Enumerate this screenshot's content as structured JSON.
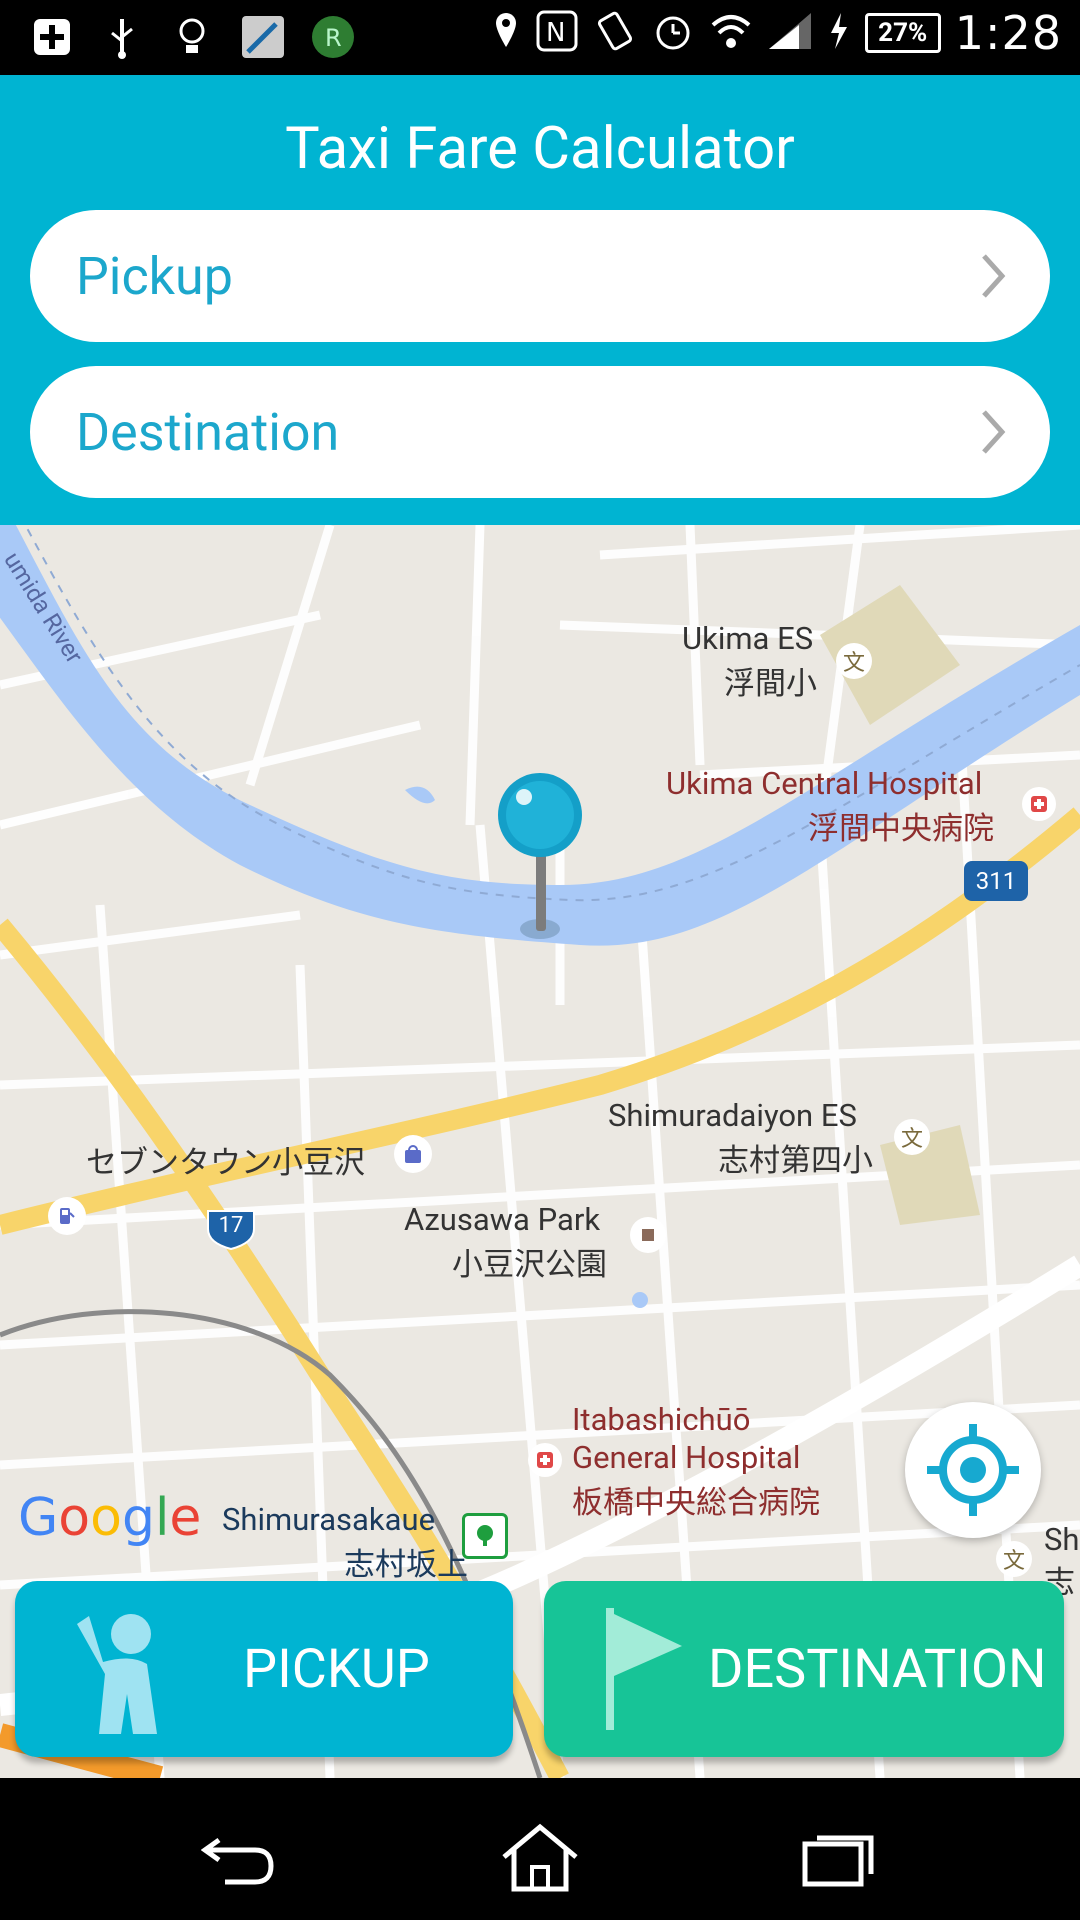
{
  "status_bar": {
    "time": "1:28",
    "battery": "27%",
    "icons": [
      "plus-box-icon",
      "usb-icon",
      "lightbulb-icon",
      "tool-app-icon",
      "r-app-icon",
      "location-icon",
      "nfc-icon",
      "vibrate-icon",
      "alarm-icon",
      "wifi-icon",
      "signal-icon",
      "charging-icon"
    ]
  },
  "header": {
    "title": "Taxi Fare Calculator",
    "pickup_placeholder": "Pickup",
    "destination_placeholder": "Destination"
  },
  "map": {
    "labels": {
      "river": "umida River",
      "ukima_es_en": "Ukima ES",
      "ukima_es_jp": "浮間小",
      "hospital1_en": "Ukima Central Hospital",
      "hospital1_jp": "浮間中央病院",
      "route_311": "311",
      "shimuradaiyon_en": "Shimuradaiyon ES",
      "shimuradaiyon_jp": "志村第四小",
      "seven_town": "セブンタウン小豆沢",
      "route_17": "17",
      "azusawa_en": "Azusawa Park",
      "azusawa_jp": "小豆沢公園",
      "itabashi_1": "Itabashichūō",
      "itabashi_2": "General Hospital",
      "itabashi_jp": "板橋中央総合病院",
      "shimurasakaue_en": "Shimurasakaue",
      "shimurasakaue_jp": "志村坂上",
      "edge_sh": "Sh",
      "edge_jp": "志"
    },
    "google_logo": "Google"
  },
  "buttons": {
    "pickup": "PICKUP",
    "destination": "DESTINATION"
  },
  "colors": {
    "header": "#00B4D2",
    "pickup_button": "#00B4D2",
    "destination_button": "#17C497",
    "field_text": "#1CA7CC",
    "river": "#A9C9F7",
    "major_road": "#F8D46A",
    "map_bg": "#EBE8E2"
  },
  "nav": [
    "back-icon",
    "home-icon",
    "recents-icon"
  ]
}
